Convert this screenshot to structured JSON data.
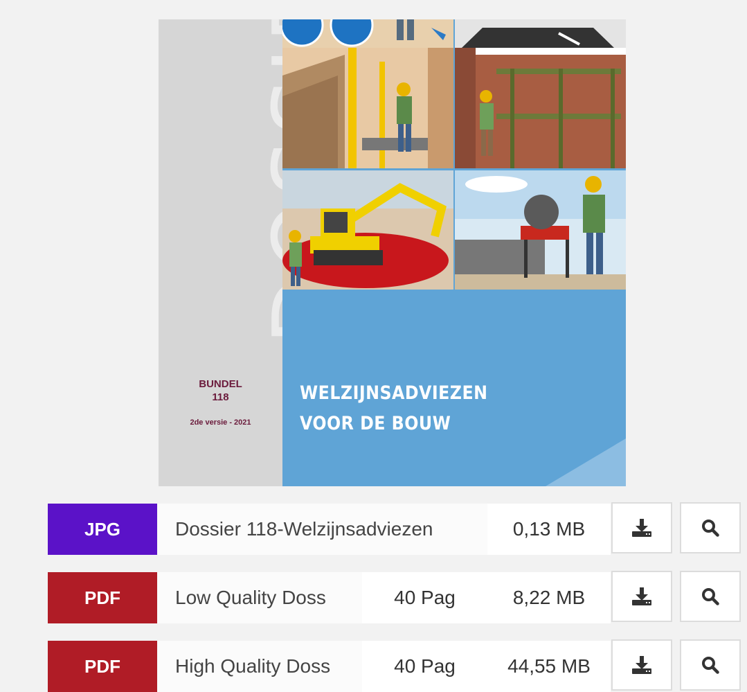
{
  "cover": {
    "vertical_title": "DOSSIER",
    "bundel_label": "BUNDEL",
    "bundel_number": "118",
    "version": "2de versie - 2021",
    "title_line1": "WELZIJNSADVIEZEN",
    "title_line2": "VOOR DE BOUW"
  },
  "files": [
    {
      "type": "JPG",
      "type_color": "#5b12c8",
      "name": "Dossier 118-Welzijnsadviezen",
      "pages": "",
      "size": "0,13 MB"
    },
    {
      "type": "PDF",
      "type_color": "#b01c26",
      "name": "Low Quality Doss",
      "pages": "40 Pag",
      "size": "8,22 MB"
    },
    {
      "type": "PDF",
      "type_color": "#b01c26",
      "name": "High Quality Doss",
      "pages": "40 Pag",
      "size": "44,55 MB"
    }
  ],
  "icons": {
    "download": "download-icon",
    "preview": "search-icon"
  }
}
